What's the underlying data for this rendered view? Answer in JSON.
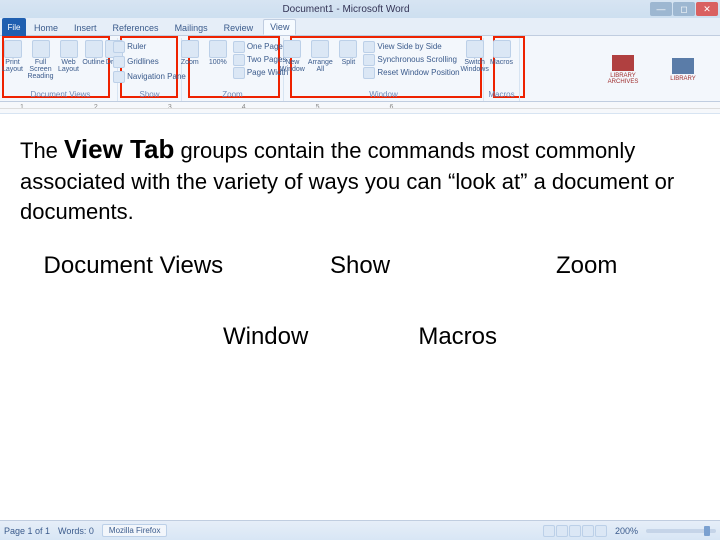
{
  "titlebar": {
    "title": "Document1 - Microsoft Word"
  },
  "tabs": {
    "file": "File",
    "items": [
      "Home",
      "Insert",
      "References",
      "Mailings",
      "Review",
      "View"
    ],
    "active": "View"
  },
  "ribbon": {
    "document_views": {
      "label": "Document Views",
      "btns": [
        "Print Layout",
        "Full Screen Reading",
        "Web Layout",
        "Outline",
        "Draft"
      ]
    },
    "show": {
      "label": "Show",
      "items": [
        "Ruler",
        "Gridlines",
        "Navigation Pane"
      ]
    },
    "zoom": {
      "label": "Zoom",
      "btns": [
        "Zoom",
        "100%"
      ],
      "list": [
        "One Page",
        "Two Pages",
        "Page Width"
      ]
    },
    "window": {
      "label": "Window",
      "btns": [
        "New Window",
        "Arrange All",
        "Split"
      ],
      "list": [
        "View Side by Side",
        "Synchronous Scrolling",
        "Reset Window Position"
      ],
      "switch": "Switch Windows"
    },
    "macros": {
      "label": "Macros",
      "btn": "Macros"
    },
    "logos": [
      "LIBRARY ARCHIVES",
      "LIBRARY"
    ]
  },
  "ruler": {
    "marks": [
      "1",
      "2",
      "3",
      "4",
      "5",
      "6"
    ]
  },
  "doc": {
    "para_prefix": "The ",
    "para_strong": "View Tab",
    "para_suffix": " groups contain the commands most commonly associated with the variety of ways you can “look at” a document or documents.",
    "labels": {
      "document_views": "Document Views",
      "show": "Show",
      "zoom": "Zoom",
      "window": "Window",
      "macros": "Macros"
    }
  },
  "status": {
    "page": "Page 1 of 1",
    "words": "Words: 0",
    "task": "Mozilla Firefox",
    "zoom": "200%"
  }
}
